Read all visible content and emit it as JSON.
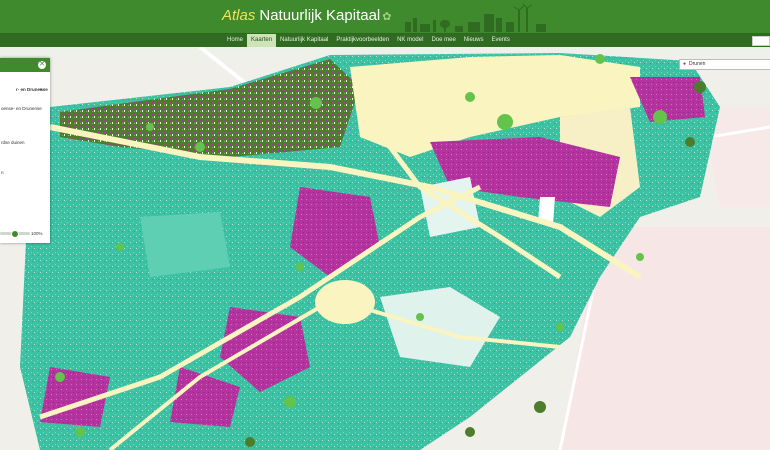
{
  "header": {
    "brand_atlas": "Atlas",
    "brand_name": "Natuurlijk Kapitaal",
    "leaf_icon": "leaf-icon"
  },
  "nav": {
    "items": [
      "Home",
      "Kaarten",
      "Natuurlijk Kapitaal",
      "Praktijkvoorbeelden",
      "NK model",
      "Doe mee",
      "Nieuws",
      "Events"
    ],
    "active_index": 1
  },
  "panel": {
    "title_fragment": "r- en Drunense",
    "subtitle_fragment": "oense- en Drunense",
    "line1": "rdse duinen",
    "line2": "n",
    "slider_label": "100%",
    "slider_value": 0.45
  },
  "geosearch": {
    "value": "Drunen"
  },
  "colors": {
    "header_green": "#3f8a2c",
    "nav_green": "#2f6b20",
    "turquoise": "#3cc1a3",
    "magenta": "#b5339f",
    "sand": "#f9f4c0",
    "dark_green": "#4b7d2a",
    "bright_green": "#63c34b"
  }
}
